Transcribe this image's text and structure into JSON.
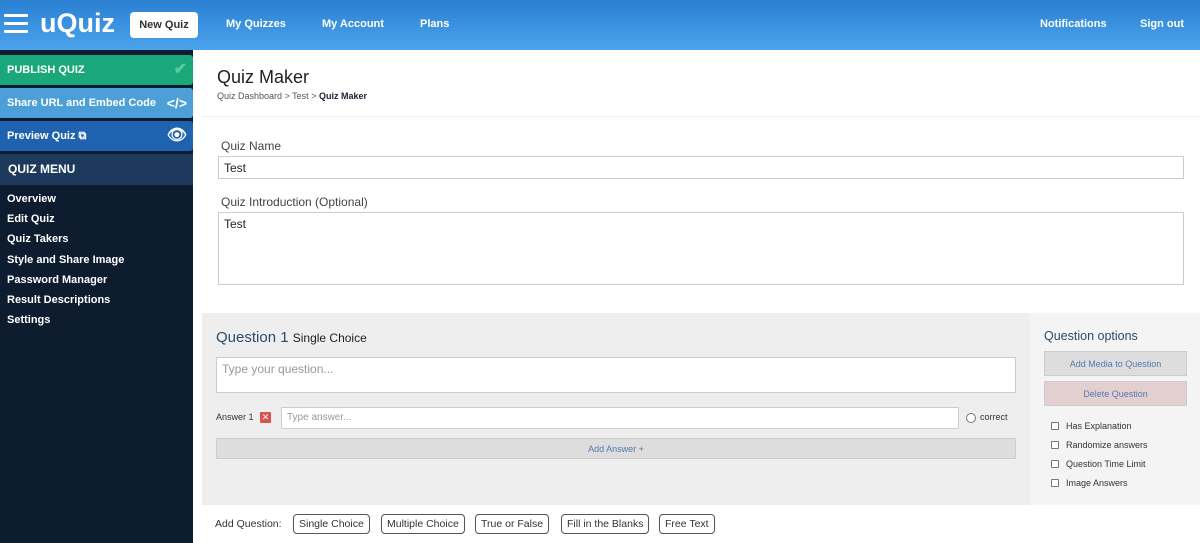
{
  "header": {
    "logo": "uQuiz",
    "new_quiz": "New Quiz",
    "nav": [
      "My Quizzes",
      "My Account",
      "Plans"
    ],
    "notifications": "Notifications",
    "sign_out": "Sign out"
  },
  "sidebar": {
    "publish": "PUBLISH QUIZ",
    "share": "Share URL and Embed Code",
    "preview": "Preview Quiz",
    "menu_title": "QUIZ MENU",
    "items": [
      "Overview",
      "Edit Quiz",
      "Quiz Takers",
      "Style and Share Image",
      "Password Manager",
      "Result Descriptions",
      "Settings"
    ]
  },
  "page": {
    "title": "Quiz Maker",
    "breadcrumb": [
      "Quiz Dashboard",
      "Test"
    ],
    "breadcrumb_current": "Quiz Maker",
    "sep": ">"
  },
  "form": {
    "name_label": "Quiz Name",
    "name_value": "Test",
    "intro_label": "Quiz Introduction (Optional)",
    "intro_value": "Test"
  },
  "question": {
    "title": "Question 1",
    "type": "Single Choice",
    "placeholder": "Type your question...",
    "answer_label": "Answer 1",
    "answer_placeholder": "Type answer...",
    "correct": "correct",
    "add_answer": "Add Answer +"
  },
  "options": {
    "title": "Question options",
    "add_media": "Add Media to Question",
    "delete": "Delete Question",
    "checks": [
      "Has Explanation",
      "Randomize answers",
      "Question Time Limit",
      "Image Answers"
    ]
  },
  "add_question": {
    "label": "Add Question:",
    "types": [
      "Single Choice",
      "Multiple Choice",
      "True or False",
      "Fill in the Blanks",
      "Free Text"
    ]
  },
  "colors": {
    "publish": "#1aa87a",
    "share": "#4d9fd8",
    "preview": "#1f63b0",
    "sidebar": "#0e1c30"
  }
}
